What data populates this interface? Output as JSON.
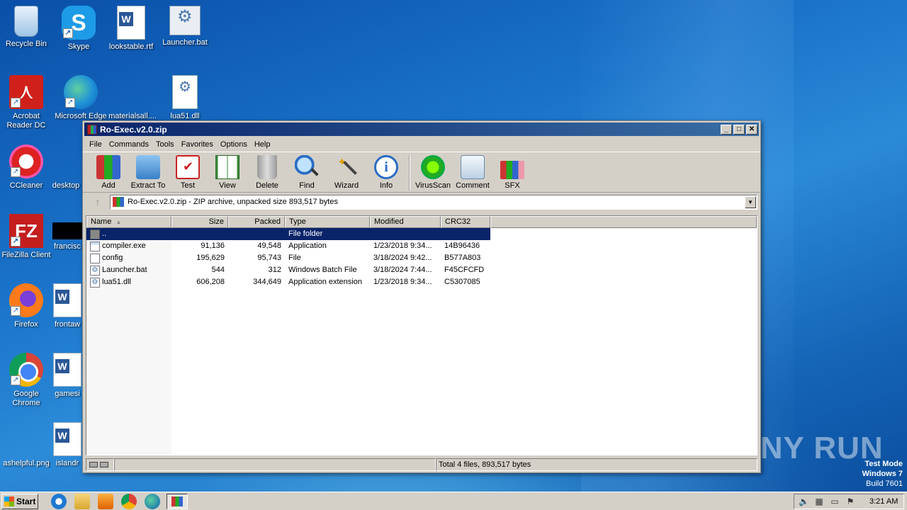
{
  "desktop": {
    "icons": [
      {
        "label": "Recycle Bin"
      },
      {
        "label": "Skype"
      },
      {
        "label": "lookstable.rtf"
      },
      {
        "label": "Launcher.bat"
      },
      {
        "label": "Acrobat Reader DC"
      },
      {
        "label": "Microsoft Edge"
      },
      {
        "label": "materialsall...."
      },
      {
        "label": "lua51.dll"
      },
      {
        "label": "CCleaner"
      },
      {
        "label": "desktop"
      },
      {
        "label": "FileZilla Client"
      },
      {
        "label": "francisc"
      },
      {
        "label": "Firefox"
      },
      {
        "label": "frontaw"
      },
      {
        "label": "Google Chrome"
      },
      {
        "label": "gamesi"
      },
      {
        "label": "ashelpful.png"
      },
      {
        "label": "islandr"
      }
    ]
  },
  "window": {
    "title": "Ro-Exec.v2.0.zip",
    "menu": [
      "File",
      "Commands",
      "Tools",
      "Favorites",
      "Options",
      "Help"
    ],
    "toolbar": [
      "Add",
      "Extract To",
      "Test",
      "View",
      "Delete",
      "Find",
      "Wizard",
      "Info",
      "VirusScan",
      "Comment",
      "SFX"
    ],
    "address": "Ro-Exec.v2.0.zip - ZIP archive, unpacked size 893,517 bytes",
    "columns": [
      "Name",
      "Size",
      "Packed",
      "Type",
      "Modified",
      "CRC32"
    ],
    "rows": [
      {
        "name": "..",
        "size": "",
        "packed": "",
        "type": "File folder",
        "modified": "",
        "crc": ""
      },
      {
        "name": "compiler.exe",
        "size": "91,136",
        "packed": "49,548",
        "type": "Application",
        "modified": "1/23/2018 9:34...",
        "crc": "14B96436"
      },
      {
        "name": "config",
        "size": "195,629",
        "packed": "95,743",
        "type": "File",
        "modified": "3/18/2024 9:42...",
        "crc": "B577A803"
      },
      {
        "name": "Launcher.bat",
        "size": "544",
        "packed": "312",
        "type": "Windows Batch File",
        "modified": "3/18/2024 7:44...",
        "crc": "F45CFCFD"
      },
      {
        "name": "lua51.dll",
        "size": "606,208",
        "packed": "344,649",
        "type": "Application extension",
        "modified": "1/23/2018 9:34...",
        "crc": "C5307085"
      }
    ],
    "status": "Total 4 files, 893,517 bytes"
  },
  "watermark": "ANY RUN",
  "testmode": {
    "line1": "Test Mode",
    "line2": "Windows 7",
    "line3": "Build 7601"
  },
  "taskbar": {
    "start": "Start",
    "clock": "3:21 AM"
  }
}
